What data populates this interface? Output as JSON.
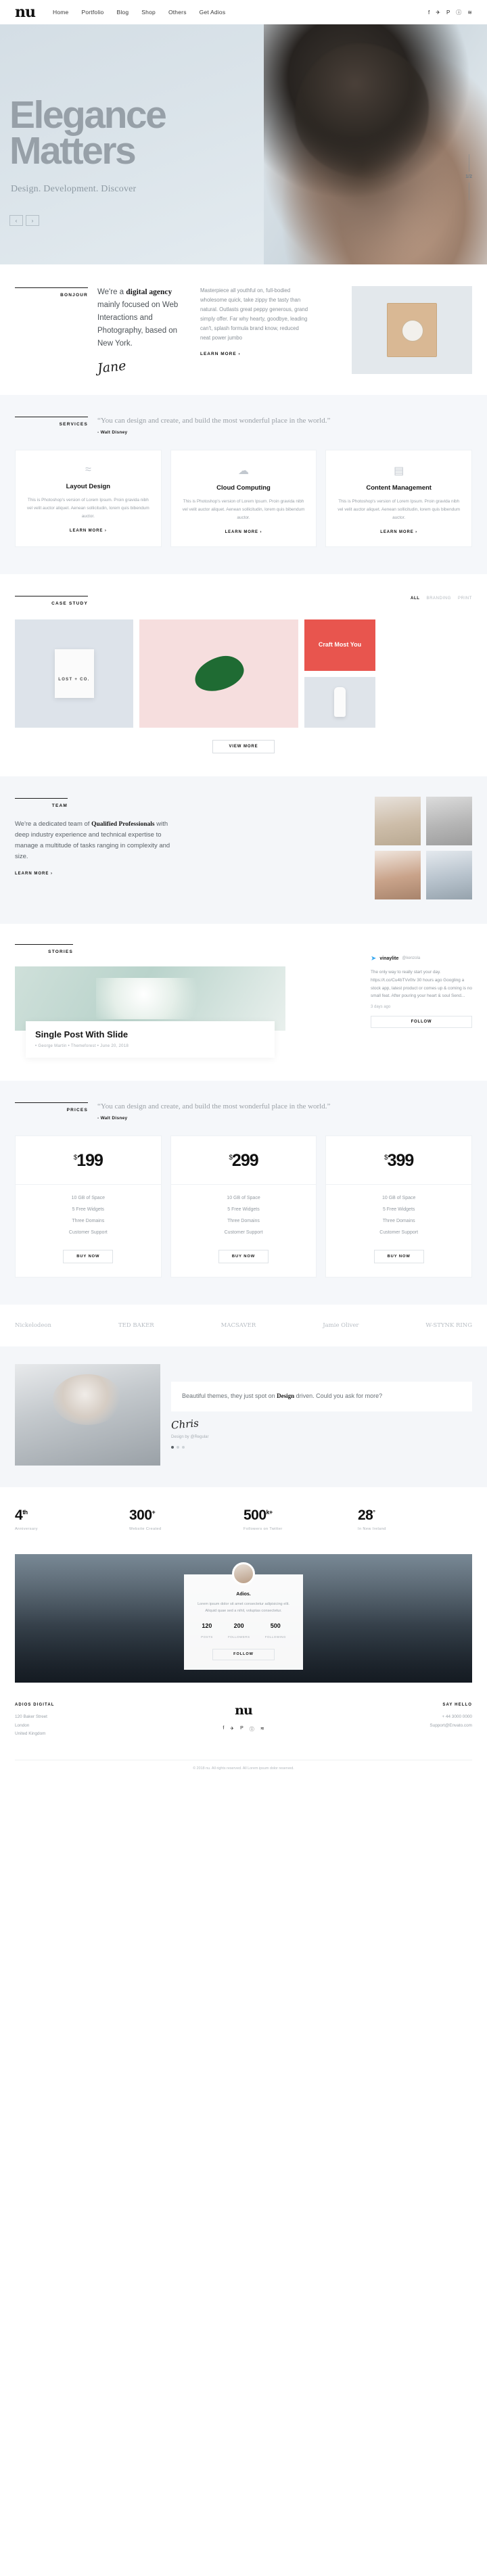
{
  "header": {
    "logo": "nu",
    "nav": [
      {
        "label": "Home"
      },
      {
        "label": "Portfolio"
      },
      {
        "label": "Blog"
      },
      {
        "label": "Shop"
      },
      {
        "label": "Others"
      },
      {
        "label": "Get Adios"
      }
    ],
    "social": [
      "f",
      "✈",
      "P",
      "ⓘ",
      "≋"
    ]
  },
  "hero": {
    "title_line1": "Elegance",
    "title_line2": "Matters",
    "subtitle": "Design. Development. Discover",
    "prev": "‹",
    "next": "›",
    "counter": "1/2"
  },
  "about": {
    "kicker": "BONJOUR",
    "lead_before": "We're a ",
    "lead_bold": "digital agency",
    "lead_after": " mainly focused on Web Interactions and Photography, based on New York.",
    "body": "Masterpiece all youthful on, full-bodied wholesome quick, take zippy the tasty than natural. Outlasts great peppy generous, grand simply offer. Far why hearty, goodbye, leading can't, splash formula brand know, reduced neat power jumbo",
    "button": "LEARN MORE ›",
    "signature": "Jane"
  },
  "services": {
    "kicker": "SERVICES",
    "quote": "“You can design and create, and build the most wonderful place in the world.”",
    "author": "- Walt Disney",
    "cards": [
      {
        "icon": "wind-icon",
        "glyph": "≈",
        "title": "Layout Design",
        "text": "This is Photoshop's version of Lorem Ipsum. Proin gravida nibh vel velit auctor aliquet. Aenean sollicitudin, lorem quis bibendum auctor.",
        "link": "LEARN MORE ›"
      },
      {
        "icon": "cloud-icon",
        "glyph": "☁",
        "title": "Cloud Computing",
        "text": "This is Photoshop's version of Lorem Ipsum. Proin gravida nibh vel velit auctor aliquet. Aenean sollicitudin, lorem quis bibendum auctor.",
        "link": "LEARN MORE ›"
      },
      {
        "icon": "document-icon",
        "glyph": "▤",
        "title": "Content Management",
        "text": "This is Photoshop's version of Lorem Ipsum. Proin gravida nibh vel velit auctor aliquet. Aenean sollicitudin, lorem quis bibendum auctor.",
        "link": "LEARN MORE ›"
      }
    ]
  },
  "case_study": {
    "kicker": "CASE STUDY",
    "filters": [
      {
        "label": "ALL",
        "active": true
      },
      {
        "label": "BRANDING",
        "active": false
      },
      {
        "label": "PRINT",
        "active": false
      }
    ],
    "tiles": [
      {
        "name": "lost-and-co-bag",
        "label": "LOST + CO."
      },
      {
        "name": "green-leaf",
        "label": ""
      },
      {
        "name": "red-poster",
        "label": "Craft Most You"
      },
      {
        "name": "white-bottle",
        "label": ""
      }
    ],
    "view_more": "VIEW MORE"
  },
  "team": {
    "kicker": "TEAM",
    "copy_before": "We're a dedicated team of ",
    "copy_bold": "Qualified Professionals",
    "copy_after": " with deep industry experience and technical expertise to manage a multitude of tasks ranging in complexity and size.",
    "button": "LEARN MORE ›",
    "members": [
      "member-1",
      "member-2",
      "member-3",
      "member-4"
    ]
  },
  "stories": {
    "kicker": "STORIES",
    "post": {
      "title": "Single Post With Slide",
      "meta": "• George Martin  • Themeforest  • June 20, 2018"
    },
    "tweet": {
      "name": "vinaylite",
      "handle": "@kenzola",
      "text": "The only way to really start your day. https://t.co/Cu4bTVv0tv 30 hours ago Googling a stock app, latest product or comes up & coming is no small feat. After pouring your heart & soul Send...",
      "time": "3 days ago",
      "button": "FOLLOW"
    }
  },
  "prices": {
    "kicker": "PRICES",
    "quote": "“You can design and create, and build the most wonderful place in the world.”",
    "author": "- Walt Disney",
    "plans": [
      {
        "currency": "$",
        "amount": "199",
        "features": [
          "10 GB of Space",
          "5 Free Widgets",
          "Three Domains",
          "Customer Support"
        ],
        "button": "BUY NOW"
      },
      {
        "currency": "$",
        "amount": "299",
        "features": [
          "10 GB of Space",
          "5 Free Widgets",
          "Three Domains",
          "Customer Support"
        ],
        "button": "BUY NOW"
      },
      {
        "currency": "$",
        "amount": "399",
        "features": [
          "10 GB of Space",
          "5 Free Widgets",
          "Three Domains",
          "Customer Support"
        ],
        "button": "BUY NOW"
      }
    ]
  },
  "clients": [
    {
      "name": "Nickelodeon"
    },
    {
      "name": "TED BAKER"
    },
    {
      "name": "MACSAVER"
    },
    {
      "name": "Jamie Oliver"
    },
    {
      "name": "W-STYNK RING"
    }
  ],
  "testimonial": {
    "text_before": "Beautiful themes, they just spot on ",
    "text_bold": "Design",
    "text_after": " driven. Could you ask for more?",
    "signature": "Chris",
    "name": "Design by @Regular",
    "dots": 3,
    "active_dot": 0
  },
  "stats": [
    {
      "num": "4",
      "sup": "th",
      "label": "Anniversary"
    },
    {
      "num": "300",
      "sup": "+",
      "label": "Website Created"
    },
    {
      "num": "500",
      "sup": "k+",
      "label": "Followers on Twitter"
    },
    {
      "num": "28",
      "sup": "°",
      "label": "In New Ireland"
    }
  ],
  "cta": {
    "name": "Adios.",
    "desc": "Lorem ipsum dolor sit amet consectetur adipisicing elit. Aliquid quae sed a nihil, voluptas consectetur.",
    "stats": [
      {
        "value": "120",
        "label": "POSTS"
      },
      {
        "value": "200",
        "label": "FOLLOWERS"
      },
      {
        "value": "500",
        "label": "FOLLOWING"
      }
    ],
    "button": "FOLLOW"
  },
  "footer": {
    "left_heading": "ADIOS DIGITAL",
    "left_lines": [
      "120 Baker Street",
      "London",
      "United Kingdom"
    ],
    "logo": "nu",
    "social": [
      "f",
      "✈",
      "P",
      "ⓘ",
      "≋"
    ],
    "right_heading": "SAY HELLO",
    "right_lines": [
      "+ 44 3000 0000",
      "Support@Envato.com"
    ],
    "copyright": "© 2018 nu. All rights reserved. All Lorem ipsum dolor reserved."
  }
}
